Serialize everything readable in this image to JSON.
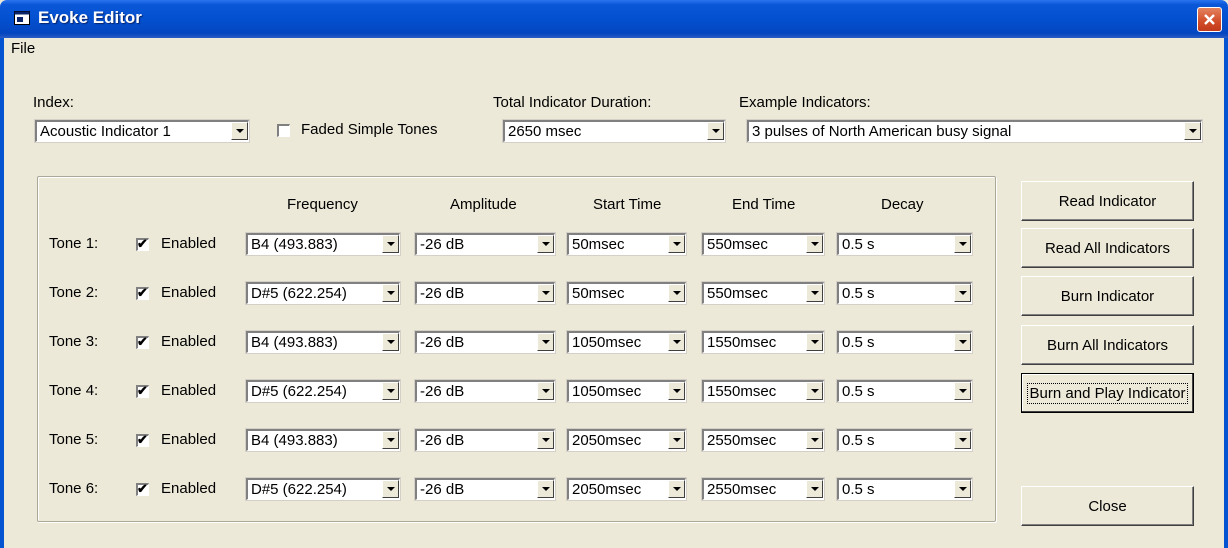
{
  "window": {
    "title": "Evoke Editor",
    "app_icon": "window-app-icon",
    "close_icon": "close-x-icon"
  },
  "menu": {
    "file": "File"
  },
  "index": {
    "label": "Index:",
    "value": "Acoustic Indicator 1"
  },
  "faded": {
    "label": "Faded Simple Tones",
    "checked": false
  },
  "duration": {
    "label": "Total Indicator Duration:",
    "value": "2650 msec"
  },
  "example": {
    "label": "Example Indicators:",
    "value": "3 pulses of North American busy signal"
  },
  "columns": {
    "frequency": "Frequency",
    "amplitude": "Amplitude",
    "start": "Start Time",
    "end": "End Time",
    "decay": "Decay"
  },
  "enabled_label": "Enabled",
  "tones": [
    {
      "label": "Tone 1:",
      "enabled": true,
      "frequency": "B4 (493.883)",
      "amplitude": "-26 dB",
      "start": "50msec",
      "end": "550msec",
      "decay": "0.5 s"
    },
    {
      "label": "Tone 2:",
      "enabled": true,
      "frequency": "D#5 (622.254)",
      "amplitude": "-26 dB",
      "start": "50msec",
      "end": "550msec",
      "decay": "0.5 s"
    },
    {
      "label": "Tone 3:",
      "enabled": true,
      "frequency": "B4 (493.883)",
      "amplitude": "-26 dB",
      "start": "1050msec",
      "end": "1550msec",
      "decay": "0.5 s"
    },
    {
      "label": "Tone 4:",
      "enabled": true,
      "frequency": "D#5 (622.254)",
      "amplitude": "-26 dB",
      "start": "1050msec",
      "end": "1550msec",
      "decay": "0.5 s"
    },
    {
      "label": "Tone 5:",
      "enabled": true,
      "frequency": "B4 (493.883)",
      "amplitude": "-26 dB",
      "start": "2050msec",
      "end": "2550msec",
      "decay": "0.5 s"
    },
    {
      "label": "Tone 6:",
      "enabled": true,
      "frequency": "D#5 (622.254)",
      "amplitude": "-26 dB",
      "start": "2050msec",
      "end": "2550msec",
      "decay": "0.5 s"
    }
  ],
  "buttons": {
    "read": "Read Indicator",
    "read_all": "Read All Indicators",
    "burn": "Burn Indicator",
    "burn_all": "Burn All Indicators",
    "burn_play": "Burn and Play Indicator",
    "close": "Close"
  }
}
